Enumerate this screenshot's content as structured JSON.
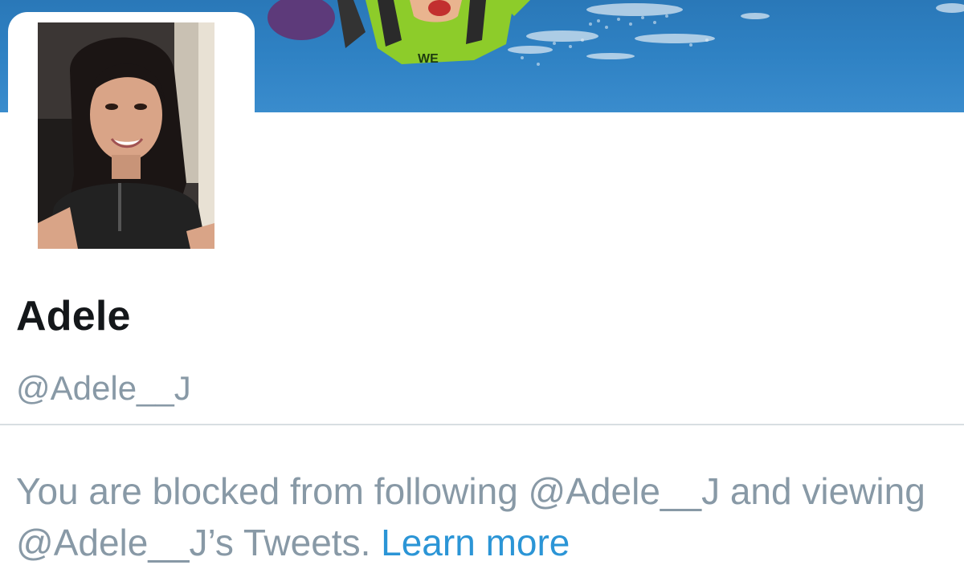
{
  "profile": {
    "display_name": "Adele",
    "handle": "@Adele__J"
  },
  "blocked_notice": {
    "text": "You are blocked from following @Adele__J and viewing @Adele__J’s Tweets.",
    "learn_more": "Learn more"
  },
  "banner": {
    "suit_text": "WE"
  },
  "colors": {
    "name": "#14171a",
    "muted": "#8899a6",
    "link": "#2b95d6",
    "divider": "#d8dee2",
    "banner_blue": "#2f82c4"
  }
}
